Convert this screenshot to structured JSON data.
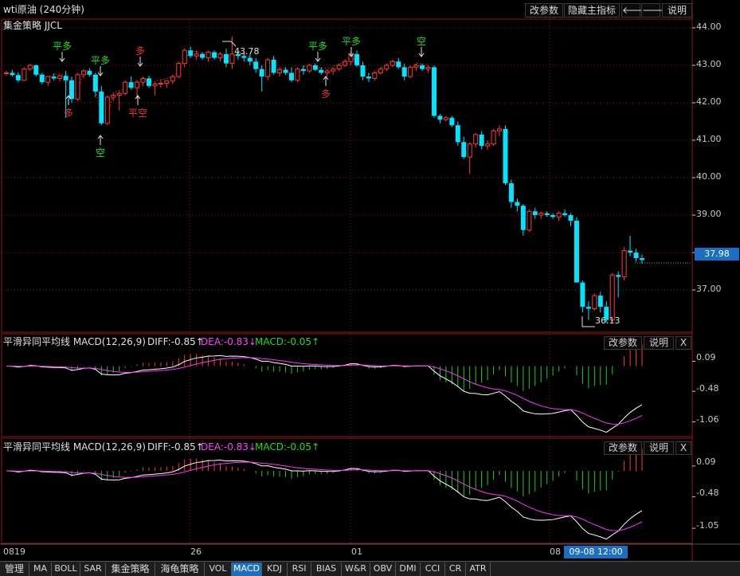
{
  "window": {
    "title": "wti原油 (240分钟)"
  },
  "toolbar": {
    "change_params": "改参数",
    "hide_main": "隐藏主指标",
    "prev_arrow": "🡐",
    "next_arrow": "🡒",
    "help": "说明"
  },
  "main_chart": {
    "indicator_name": "集金策略 JJCL",
    "y_ticks": [
      "44.00",
      "43.00",
      "42.00",
      "41.00",
      "40.00",
      "39.00",
      "37.00"
    ],
    "last_price": "37.98",
    "high_label": "43.78",
    "low_label": "36.13",
    "signals": [
      {
        "text": "平多",
        "color": "#22dd22",
        "dir": "down"
      },
      {
        "text": "多",
        "color": "#ee3333",
        "dir": "up"
      },
      {
        "text": "平多",
        "color": "#22dd22",
        "dir": "down"
      },
      {
        "text": "空",
        "color": "#22dd22",
        "dir": "up"
      },
      {
        "text": "多",
        "color": "#ee3333",
        "dir": "down"
      },
      {
        "text": "平空",
        "color": "#ee3333",
        "dir": "up"
      },
      {
        "text": "平多",
        "color": "#22dd22",
        "dir": "down"
      },
      {
        "text": "多",
        "color": "#ee3333",
        "dir": "up"
      },
      {
        "text": "平多",
        "color": "#22dd22",
        "dir": "down"
      },
      {
        "text": "空",
        "color": "#22dd22",
        "dir": "down"
      }
    ]
  },
  "macd_panels": [
    {
      "title": "平滑异同平均线 MACD(12,26,9)",
      "diff_label": "DIFF:-0.85↑",
      "dea_label": "DEA:-0.83↓",
      "macd_label": "MACD:-0.05↑",
      "y_ticks": [
        "0.09",
        "-0.48",
        "-1.06"
      ],
      "buttons": {
        "change_params": "改参数",
        "help": "说明",
        "close": "X"
      }
    },
    {
      "title": "平滑异同平均线 MACD(12,26,9)",
      "diff_label": "DIFF:-0.85↑",
      "dea_label": "DEA:-0.83↓",
      "macd_label": "MACD:-0.05↑",
      "y_ticks": [
        "0.09",
        "-0.48",
        "-1.05"
      ],
      "buttons": {
        "change_params": "改参数",
        "help": "说明",
        "close": "X"
      }
    }
  ],
  "x_axis": {
    "labels": [
      "0819",
      "26",
      "01",
      "08"
    ],
    "cursor_label": "09-08 12:00"
  },
  "tabs": [
    "管理",
    "MA",
    "BOLL",
    "SAR",
    "集金策略",
    "海龟策略",
    "VOL",
    "MACD",
    "KDJ",
    "RSI",
    "BIAS",
    "W&R",
    "OBV",
    "DMI",
    "CCI",
    "CR",
    "ATR"
  ],
  "colors": {
    "up": "#ff3b3b",
    "down": "#00e5ff",
    "diff": "#ffffff",
    "dea": "#ff33ff",
    "macd_pos": "#ff3b3b",
    "macd_neg": "#22cc22",
    "grid": "#8b1a1a",
    "accent": "#1a6fc2"
  },
  "chart_data": {
    "type": "candlestick",
    "timeframe": "240分钟",
    "x_labels": [
      "0819",
      "26",
      "01",
      "08"
    ],
    "ylim": [
      36.0,
      44.2
    ],
    "candles": [
      [
        42.78,
        42.85,
        42.72,
        42.8
      ],
      [
        42.8,
        42.88,
        42.7,
        42.74
      ],
      [
        42.74,
        42.82,
        42.55,
        42.6
      ],
      [
        42.6,
        42.95,
        42.58,
        42.9
      ],
      [
        42.9,
        43.05,
        42.85,
        43.0
      ],
      [
        43.0,
        43.02,
        42.7,
        42.75
      ],
      [
        42.75,
        42.8,
        42.5,
        42.55
      ],
      [
        42.55,
        42.72,
        42.45,
        42.7
      ],
      [
        42.7,
        42.78,
        42.6,
        42.65
      ],
      [
        42.65,
        42.75,
        42.58,
        42.72
      ],
      [
        42.72,
        42.85,
        41.6,
        42.6
      ],
      [
        42.6,
        42.7,
        42.0,
        42.1
      ],
      [
        42.1,
        42.8,
        42.05,
        42.75
      ],
      [
        42.75,
        42.9,
        42.65,
        42.85
      ],
      [
        42.85,
        42.92,
        42.7,
        42.75
      ],
      [
        42.75,
        42.8,
        42.15,
        42.3
      ],
      [
        42.3,
        42.45,
        41.4,
        41.45
      ],
      [
        41.45,
        42.2,
        41.4,
        42.15
      ],
      [
        42.15,
        42.25,
        42.05,
        42.2
      ],
      [
        42.2,
        42.3,
        41.8,
        42.25
      ],
      [
        42.25,
        42.6,
        42.2,
        42.55
      ],
      [
        42.55,
        42.7,
        42.35,
        42.4
      ],
      [
        42.4,
        42.6,
        42.1,
        42.55
      ],
      [
        42.55,
        42.7,
        42.45,
        42.65
      ],
      [
        42.65,
        42.72,
        42.4,
        42.45
      ],
      [
        42.45,
        42.55,
        42.2,
        42.5
      ],
      [
        42.5,
        42.6,
        42.4,
        42.52
      ],
      [
        42.52,
        42.6,
        42.4,
        42.58
      ],
      [
        42.58,
        42.75,
        42.5,
        42.7
      ],
      [
        42.7,
        43.1,
        42.65,
        43.05
      ],
      [
        43.05,
        43.45,
        42.95,
        43.4
      ],
      [
        43.4,
        43.5,
        43.2,
        43.25
      ],
      [
        43.25,
        43.4,
        43.15,
        43.3
      ],
      [
        43.3,
        43.35,
        43.15,
        43.2
      ],
      [
        43.2,
        43.4,
        43.1,
        43.35
      ],
      [
        43.35,
        43.4,
        43.15,
        43.2
      ],
      [
        43.2,
        43.35,
        43.1,
        43.3
      ],
      [
        43.3,
        43.45,
        42.95,
        43.05
      ],
      [
        43.05,
        43.78,
        42.9,
        43.3
      ],
      [
        43.3,
        43.4,
        43.15,
        43.25
      ],
      [
        43.25,
        43.35,
        43.1,
        43.2
      ],
      [
        43.2,
        43.3,
        43.0,
        43.1
      ],
      [
        43.1,
        43.2,
        42.8,
        42.9
      ],
      [
        42.9,
        43.0,
        42.3,
        42.7
      ],
      [
        42.7,
        43.2,
        42.6,
        43.15
      ],
      [
        43.15,
        43.25,
        42.75,
        42.8
      ],
      [
        42.8,
        42.95,
        42.7,
        42.88
      ],
      [
        42.88,
        42.95,
        42.75,
        42.8
      ],
      [
        42.8,
        42.95,
        42.55,
        42.6
      ],
      [
        42.6,
        42.95,
        42.55,
        42.9
      ],
      [
        42.9,
        43.0,
        42.75,
        42.85
      ],
      [
        42.85,
        43.05,
        42.8,
        43.0
      ],
      [
        43.0,
        43.05,
        42.85,
        42.88
      ],
      [
        42.88,
        42.95,
        42.75,
        42.8
      ],
      [
        42.8,
        42.9,
        42.7,
        42.85
      ],
      [
        42.85,
        42.95,
        42.75,
        42.9
      ],
      [
        42.9,
        43.05,
        42.85,
        43.0
      ],
      [
        43.0,
        43.15,
        42.95,
        43.1
      ],
      [
        43.1,
        43.35,
        43.0,
        43.3
      ],
      [
        43.3,
        43.4,
        42.95,
        43.0
      ],
      [
        43.0,
        43.1,
        42.6,
        42.7
      ],
      [
        42.7,
        42.8,
        42.55,
        42.65
      ],
      [
        42.65,
        42.85,
        42.6,
        42.8
      ],
      [
        42.8,
        42.95,
        42.75,
        42.9
      ],
      [
        42.9,
        43.05,
        42.85,
        43.0
      ],
      [
        43.0,
        43.15,
        42.95,
        43.1
      ],
      [
        43.1,
        43.2,
        42.9,
        42.95
      ],
      [
        42.95,
        43.05,
        42.6,
        42.7
      ],
      [
        42.7,
        43.0,
        42.65,
        42.95
      ],
      [
        42.95,
        43.05,
        42.85,
        43.0
      ],
      [
        43.0,
        43.05,
        42.85,
        42.9
      ],
      [
        42.9,
        43.0,
        42.8,
        42.95
      ],
      [
        42.95,
        43.0,
        41.6,
        41.65
      ],
      [
        41.65,
        41.7,
        41.45,
        41.55
      ],
      [
        41.55,
        41.65,
        41.5,
        41.6
      ],
      [
        41.6,
        41.65,
        41.35,
        41.4
      ],
      [
        41.4,
        41.5,
        40.85,
        40.95
      ],
      [
        40.95,
        41.1,
        40.5,
        40.55
      ],
      [
        40.55,
        40.95,
        40.1,
        40.9
      ],
      [
        40.9,
        41.2,
        40.8,
        41.15
      ],
      [
        41.15,
        41.25,
        40.75,
        40.85
      ],
      [
        40.85,
        41.0,
        40.75,
        40.9
      ],
      [
        40.9,
        41.3,
        40.85,
        41.25
      ],
      [
        41.25,
        41.4,
        41.1,
        41.3
      ],
      [
        41.3,
        41.4,
        39.8,
        39.85
      ],
      [
        39.85,
        39.95,
        39.2,
        39.35
      ],
      [
        39.35,
        39.45,
        39.1,
        39.25
      ],
      [
        39.25,
        39.3,
        38.45,
        38.6
      ],
      [
        38.6,
        39.15,
        38.55,
        39.1
      ],
      [
        39.1,
        39.2,
        38.9,
        39.0
      ],
      [
        39.0,
        39.1,
        38.9,
        39.05
      ],
      [
        39.05,
        39.1,
        38.95,
        39.0
      ],
      [
        39.0,
        39.05,
        38.9,
        38.95
      ],
      [
        38.95,
        39.1,
        38.85,
        39.05
      ],
      [
        39.05,
        39.15,
        38.95,
        39.0
      ],
      [
        39.0,
        39.05,
        38.7,
        38.85
      ],
      [
        38.85,
        38.95,
        37.2,
        37.2
      ],
      [
        37.2,
        37.25,
        36.4,
        36.55
      ],
      [
        36.55,
        36.7,
        36.2,
        36.5
      ],
      [
        36.5,
        36.9,
        36.45,
        36.85
      ],
      [
        36.85,
        36.95,
        36.4,
        36.55
      ],
      [
        36.55,
        36.7,
        36.13,
        36.2
      ],
      [
        36.2,
        37.45,
        36.15,
        37.4
      ],
      [
        37.4,
        37.5,
        36.8,
        37.35
      ],
      [
        37.35,
        38.15,
        37.25,
        38.05
      ],
      [
        38.05,
        38.45,
        37.9,
        38.0
      ],
      [
        38.0,
        38.1,
        37.75,
        37.85
      ],
      [
        37.85,
        37.95,
        37.7,
        37.8
      ]
    ],
    "last": 37.98,
    "high": 43.78,
    "low": 36.13,
    "macd_ylim": [
      -1.25,
      0.28
    ],
    "macd_ticks": [
      0.09,
      -0.48,
      -1.06
    ]
  }
}
